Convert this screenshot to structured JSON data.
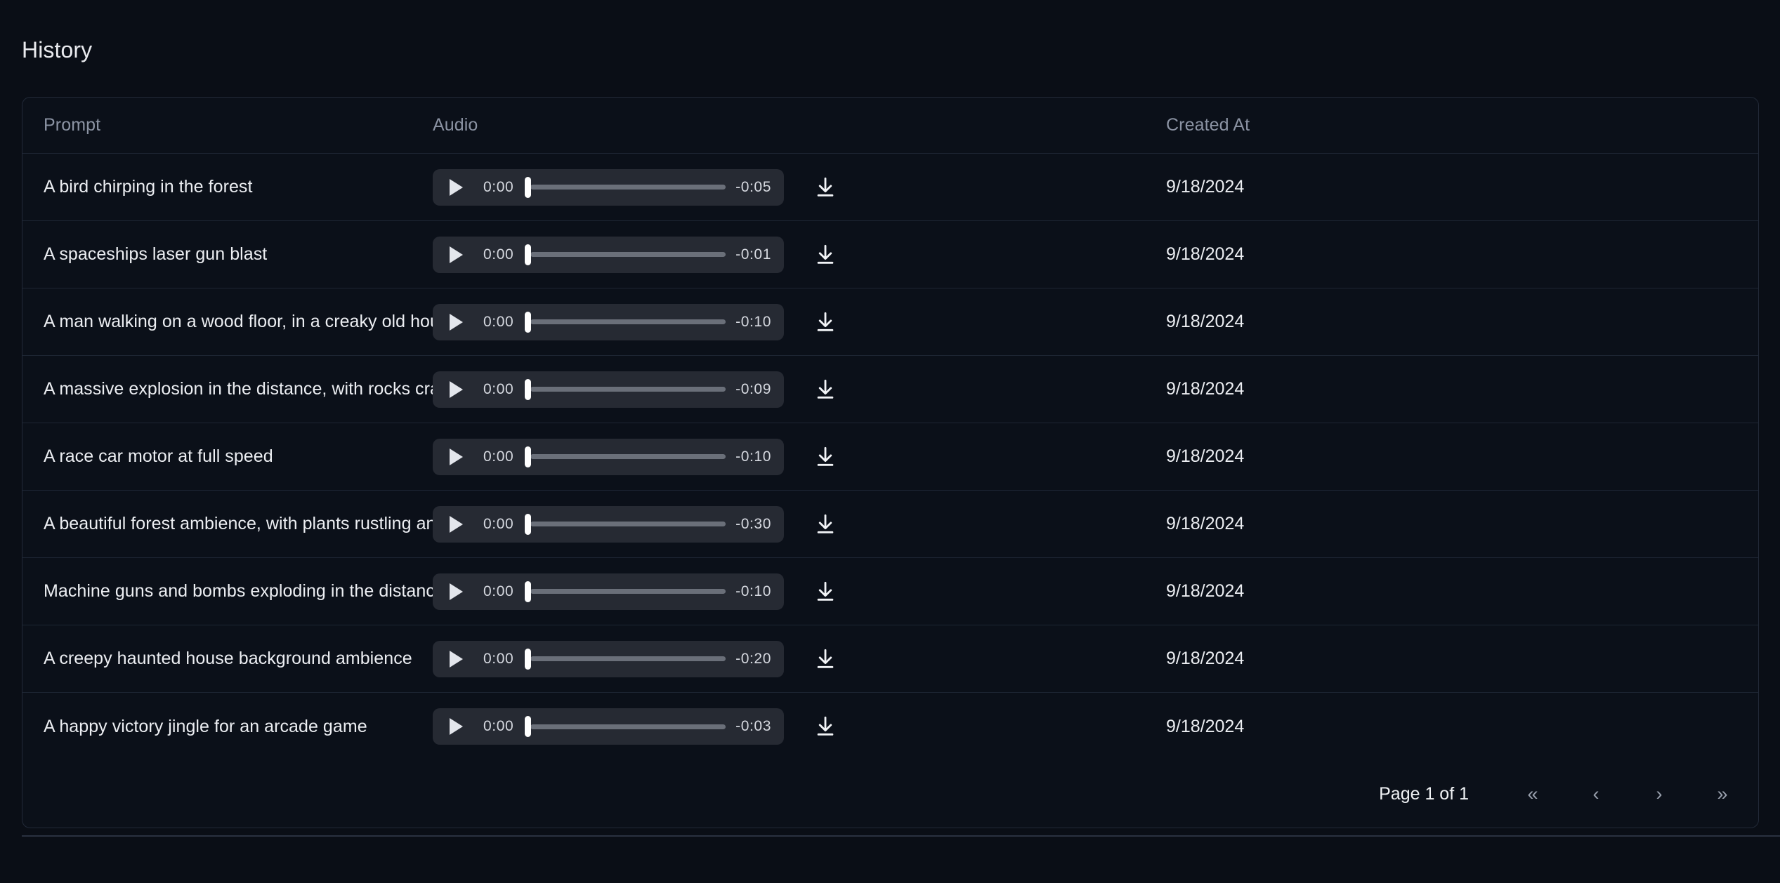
{
  "page": {
    "title": "History",
    "background_color": "#0a0e16",
    "card_background_color": "#0b1019",
    "border_color": "#222a38",
    "text_color": "#eceef2",
    "muted_text_color": "#8b93a3"
  },
  "table": {
    "columns": [
      {
        "key": "prompt",
        "label": "Prompt"
      },
      {
        "key": "audio",
        "label": "Audio"
      },
      {
        "key": "created",
        "label": "Created At"
      }
    ],
    "rows": [
      {
        "prompt": "A bird chirping in the forest",
        "audio": {
          "current_time": "0:00",
          "remaining_time": "-0:05",
          "progress_percent": 0,
          "play_icon": "play-icon",
          "download_icon": "download-icon"
        },
        "created_at": "9/18/2024"
      },
      {
        "prompt": "A spaceships laser gun blast",
        "audio": {
          "current_time": "0:00",
          "remaining_time": "-0:01",
          "progress_percent": 0,
          "play_icon": "play-icon",
          "download_icon": "download-icon"
        },
        "created_at": "9/18/2024"
      },
      {
        "prompt": "A man walking on a wood floor, in a creaky old house",
        "audio": {
          "current_time": "0:00",
          "remaining_time": "-0:10",
          "progress_percent": 0,
          "play_icon": "play-icon",
          "download_icon": "download-icon"
        },
        "created_at": "9/18/2024"
      },
      {
        "prompt": "A massive explosion in the distance, with rocks crashing down after",
        "audio": {
          "current_time": "0:00",
          "remaining_time": "-0:09",
          "progress_percent": 0,
          "play_icon": "play-icon",
          "download_icon": "download-icon"
        },
        "created_at": "9/18/2024"
      },
      {
        "prompt": "A race car motor at full speed",
        "audio": {
          "current_time": "0:00",
          "remaining_time": "-0:10",
          "progress_percent": 0,
          "play_icon": "play-icon",
          "download_icon": "download-icon"
        },
        "created_at": "9/18/2024"
      },
      {
        "prompt": "A beautiful forest ambience, with plants rustling and birds chirping",
        "audio": {
          "current_time": "0:00",
          "remaining_time": "-0:30",
          "progress_percent": 0,
          "play_icon": "play-icon",
          "download_icon": "download-icon"
        },
        "created_at": "9/18/2024"
      },
      {
        "prompt": "Machine guns and bombs exploding in the distance",
        "audio": {
          "current_time": "0:00",
          "remaining_time": "-0:10",
          "progress_percent": 0,
          "play_icon": "play-icon",
          "download_icon": "download-icon"
        },
        "created_at": "9/18/2024"
      },
      {
        "prompt": "A creepy haunted house background ambience",
        "audio": {
          "current_time": "0:00",
          "remaining_time": "-0:20",
          "progress_percent": 0,
          "play_icon": "play-icon",
          "download_icon": "download-icon"
        },
        "created_at": "9/18/2024"
      },
      {
        "prompt": "A happy victory jingle for an arcade game",
        "audio": {
          "current_time": "0:00",
          "remaining_time": "-0:03",
          "progress_percent": 0,
          "play_icon": "play-icon",
          "download_icon": "download-icon"
        },
        "created_at": "9/18/2024"
      }
    ]
  },
  "pagination": {
    "page_label": "Page 1 of 1",
    "current_page": 1,
    "total_pages": 1,
    "buttons": [
      {
        "name": "first-page",
        "glyph": "«"
      },
      {
        "name": "previous-page",
        "glyph": "‹"
      },
      {
        "name": "next-page",
        "glyph": "›"
      },
      {
        "name": "last-page",
        "glyph": "»"
      }
    ]
  }
}
